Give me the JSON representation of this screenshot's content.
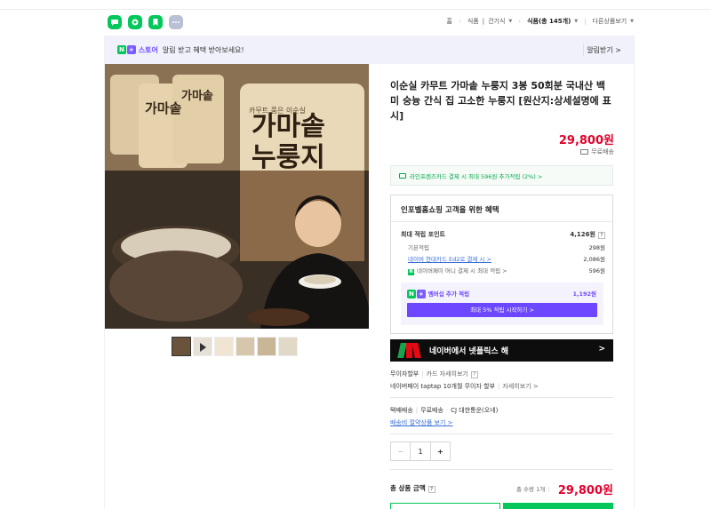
{
  "header": {
    "nav": {
      "home": "홈",
      "cat1": "식품",
      "cat2": "건기식",
      "cat3": "식품(총 145개)",
      "other": "다른상품보기"
    }
  },
  "banner": {
    "badge_n": "N",
    "badge_plus": "+",
    "store": "스토어",
    "text": "알림 받고 혜택 받아보세요!",
    "alert_button": "알림받기 >"
  },
  "product": {
    "title": "이순실 카무트 가마솥 누룽지 3봉 50회분 국내산 백미 숭늉 간식 집 고소한 누룽지 [원산지:상세설명에 표시]",
    "price": "29,800원",
    "shipping": "무료배송",
    "image_text_main": "가마솥\n누룽지",
    "image_brand": "카무트 품은 이순실"
  },
  "card_benefit": "라인프렌즈카드 결제 시 최대 596원 추가적립 (2%) >",
  "benefits": {
    "title": "인포벨홈쇼핑 고객을 위한 혜택",
    "max_points_label": "최대 적립 포인트",
    "max_points_value": "4,126원",
    "basic_label": "기본적립",
    "basic_value": "298원",
    "hyundai_label": "네이버 현대카드 Ed2로 결제 시 >",
    "hyundai_value": "2,086원",
    "npay_label": "네이버페이 머니 결제 시 최대 적립 >",
    "npay_value": "596원",
    "member_label": "멤버십 추가 적립",
    "member_value": "1,192원",
    "member_button": "최대 5% 적립 시작하기 >"
  },
  "netflix": {
    "text": "네이버에서 넷플릭스 해",
    "arrow": ">"
  },
  "installment": {
    "row1_a": "무이자할부",
    "row1_b": "카드 자세히보기",
    "row2_a": "네이버페이 taptap 10개월 무이자 할부",
    "row2_b": "자세히보기 >"
  },
  "delivery": {
    "label": "택배배송",
    "free": "무료배송",
    "courier": "CJ 대한통운(오네)",
    "save_link": "배송비 절약상품 보기 >"
  },
  "quantity": {
    "minus": "−",
    "value": "1",
    "plus": "+"
  },
  "total": {
    "label": "총 상품 금액",
    "count": "총 수량 1개",
    "price": "29,800원"
  },
  "colors": {
    "accent_red": "#e4002b",
    "naver_green": "#03c75a",
    "purple": "#6c47ff"
  }
}
